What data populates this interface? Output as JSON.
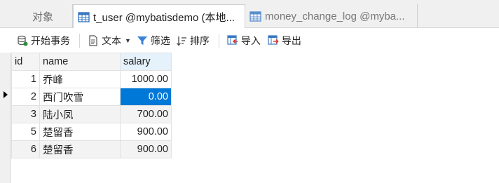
{
  "tabs": [
    {
      "label": "对象",
      "icon": "none"
    },
    {
      "label": "t_user @mybatisdemo (本地...",
      "icon": "table-icon",
      "active": true
    },
    {
      "label": "money_change_log @myba...",
      "icon": "table-icon"
    }
  ],
  "toolbar": {
    "begin_transaction": "开始事务",
    "text": "文本",
    "filter": "筛选",
    "sort": "排序",
    "import": "导入",
    "export": "导出"
  },
  "grid": {
    "columns": [
      "id",
      "name",
      "salary"
    ],
    "rows": [
      {
        "id": "1",
        "name": "乔峰",
        "salary": "1000.00"
      },
      {
        "id": "2",
        "name": "西门吹雪",
        "salary": "0.00"
      },
      {
        "id": "3",
        "name": "陆小凤",
        "salary": "700.00"
      },
      {
        "id": "5",
        "name": "楚留香",
        "salary": "900.00"
      },
      {
        "id": "6",
        "name": "楚留香",
        "salary": "900.00"
      }
    ],
    "current_row": 2,
    "selected_cell": "salary"
  },
  "colors": {
    "selection": "#0078d7",
    "tab_active_bg": "#ffffff",
    "tabbar_bg": "#f0f0f0"
  }
}
